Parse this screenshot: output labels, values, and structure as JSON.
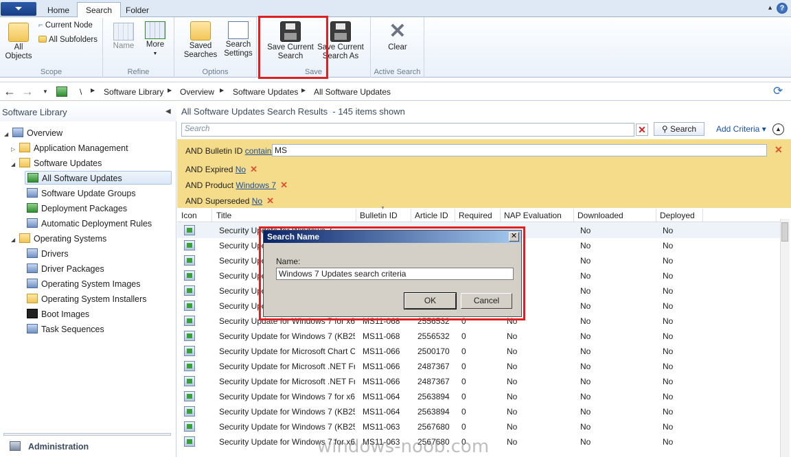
{
  "tabs": [
    {
      "label": "Home",
      "active": false
    },
    {
      "label": "Search",
      "active": true
    },
    {
      "label": "Folder",
      "active": false
    }
  ],
  "ribbon": {
    "scope": {
      "label": "Scope",
      "all_objects": "All\nObjects",
      "current_node": "Current Node",
      "all_subfolders": "All Subfolders"
    },
    "refine": {
      "label": "Refine",
      "name": "Name",
      "more": "More"
    },
    "options": {
      "label": "Options",
      "saved_searches": "Saved\nSearches",
      "search_settings": "Search\nSettings"
    },
    "save": {
      "label": "Save",
      "save_current": "Save Current\nSearch",
      "save_current_as": "Save Current\nSearch As"
    },
    "active_search": {
      "label": "Active Search",
      "clear": "Clear"
    }
  },
  "breadcrumb": [
    "\\",
    "Software Library",
    "Overview",
    "Software Updates",
    "All Software Updates"
  ],
  "left_panel": {
    "title": "Software Library",
    "items": [
      {
        "label": "Overview",
        "level": 0,
        "expanded": true
      },
      {
        "label": "Application Management",
        "level": 1,
        "expanded": false
      },
      {
        "label": "Software Updates",
        "level": 1,
        "expanded": true
      },
      {
        "label": "All Software Updates",
        "level": 2,
        "selected": true
      },
      {
        "label": "Software Update Groups",
        "level": 2
      },
      {
        "label": "Deployment Packages",
        "level": 2
      },
      {
        "label": "Automatic Deployment Rules",
        "level": 2
      },
      {
        "label": "Operating Systems",
        "level": 1,
        "expanded": true
      },
      {
        "label": "Drivers",
        "level": 2
      },
      {
        "label": "Driver Packages",
        "level": 2
      },
      {
        "label": "Operating System Images",
        "level": 2
      },
      {
        "label": "Operating System Installers",
        "level": 2
      },
      {
        "label": "Boot Images",
        "level": 2
      },
      {
        "label": "Task Sequences",
        "level": 2
      }
    ],
    "footer": "Administration"
  },
  "results": {
    "title": "All Software Updates Search Results",
    "count": "-  145 items shown",
    "search_placeholder": "Search",
    "search_button": "Search",
    "add_criteria": "Add Criteria ▾",
    "criteria": [
      {
        "op": "AND",
        "field": "Bulletin ID",
        "cond": "contains",
        "value": "MS"
      },
      {
        "op": "AND",
        "field": "Expired",
        "value": "No"
      },
      {
        "op": "AND",
        "field": "Product",
        "value": "Windows 7"
      },
      {
        "op": "AND",
        "field": "Superseded",
        "value": "No"
      }
    ],
    "columns": [
      "Icon",
      "Title",
      "Bulletin ID",
      "Article ID",
      "Required",
      "NAP Evaluation",
      "Downloaded",
      "Deployed"
    ],
    "rows": [
      [
        "Security Update for Windows 7",
        "",
        "",
        "",
        "",
        "No",
        "No"
      ],
      [
        "Security Update for Windows 7",
        "",
        "",
        "",
        "",
        "No",
        "No"
      ],
      [
        "Security Update for Windows 7",
        "",
        "",
        "",
        "",
        "No",
        "No"
      ],
      [
        "Security Update for Windows 7",
        "",
        "",
        "",
        "",
        "No",
        "No"
      ],
      [
        "Security Update for Windows 7",
        "",
        "",
        "",
        "",
        "No",
        "No"
      ],
      [
        "Security Update for Windows 7",
        "",
        "",
        "",
        "",
        "No",
        "No"
      ],
      [
        "Security Update for Windows 7 for x6...",
        "MS11-068",
        "2556532",
        "0",
        "No",
        "No",
        "No"
      ],
      [
        "Security Update for Windows 7 (KB25...",
        "MS11-068",
        "2556532",
        "0",
        "No",
        "No",
        "No"
      ],
      [
        "Security Update for Microsoft Chart Co...",
        "MS11-066",
        "2500170",
        "0",
        "No",
        "No",
        "No"
      ],
      [
        "Security Update for Microsoft .NET Fra...",
        "MS11-066",
        "2487367",
        "0",
        "No",
        "No",
        "No"
      ],
      [
        "Security Update for Microsoft .NET Fra...",
        "MS11-066",
        "2487367",
        "0",
        "No",
        "No",
        "No"
      ],
      [
        "Security Update for Windows 7 for x6...",
        "MS11-064",
        "2563894",
        "0",
        "No",
        "No",
        "No"
      ],
      [
        "Security Update for Windows 7 (KB25...",
        "MS11-064",
        "2563894",
        "0",
        "No",
        "No",
        "No"
      ],
      [
        "Security Update for Windows 7 (KB25...",
        "MS11-063",
        "2567680",
        "0",
        "No",
        "No",
        "No"
      ],
      [
        "Security Update for Windows 7 for x6...",
        "MS11-063",
        "2567680",
        "0",
        "No",
        "No",
        "No"
      ]
    ]
  },
  "dialog": {
    "title": "Search Name",
    "name_label": "Name:",
    "name_value": "Windows 7 Updates search criteria",
    "ok": "OK",
    "cancel": "Cancel"
  },
  "watermark": "windows-noob.com"
}
